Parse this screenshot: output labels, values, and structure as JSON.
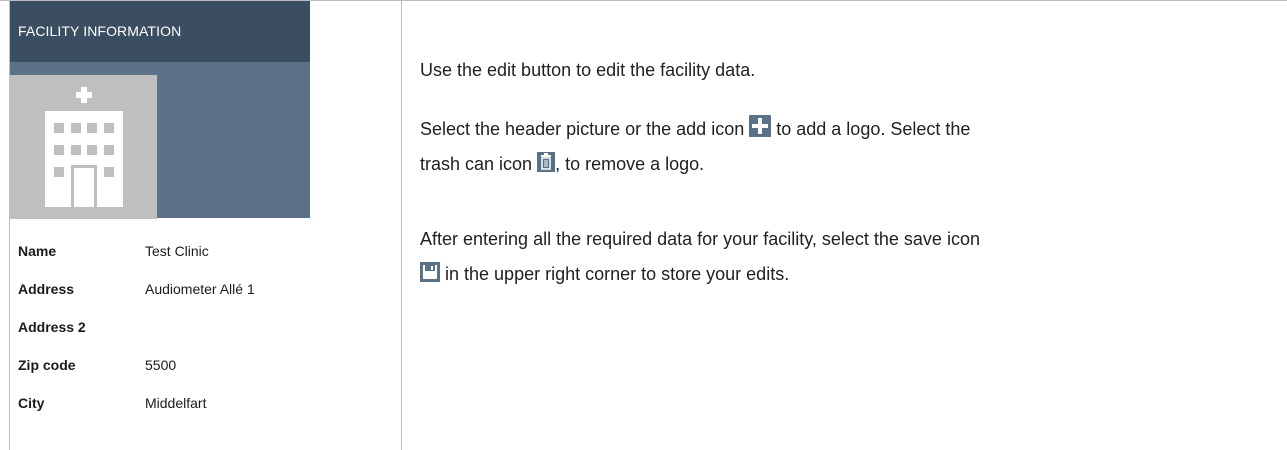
{
  "panel": {
    "title": "FACILITY INFORMATION",
    "picture_icon": "hospital-building-icon",
    "fields": [
      {
        "label": "Name",
        "value": "Test Clinic"
      },
      {
        "label": "Address",
        "value": "Audiometer Allé 1"
      },
      {
        "label": "Address 2",
        "value": ""
      },
      {
        "label": "Zip code",
        "value": "5500"
      },
      {
        "label": "City",
        "value": "Middelfart"
      }
    ]
  },
  "help": {
    "p1": "Use the edit button to edit the facility data.",
    "p2_a": "Select the header picture or the add icon",
    "p2_b": "to add a logo. Select the",
    "p2_c": "trash can icon",
    "p2_d": ", to remove a logo.",
    "p3_a": "After entering all the required data for your facility, select the save icon",
    "p3_b": "in the upper right corner to store your edits."
  },
  "colors": {
    "header_bg": "#3a4d61",
    "picture_bg": "#5b7188",
    "icon_bg": "#5b7188",
    "icon_fg": "#ffffff"
  }
}
